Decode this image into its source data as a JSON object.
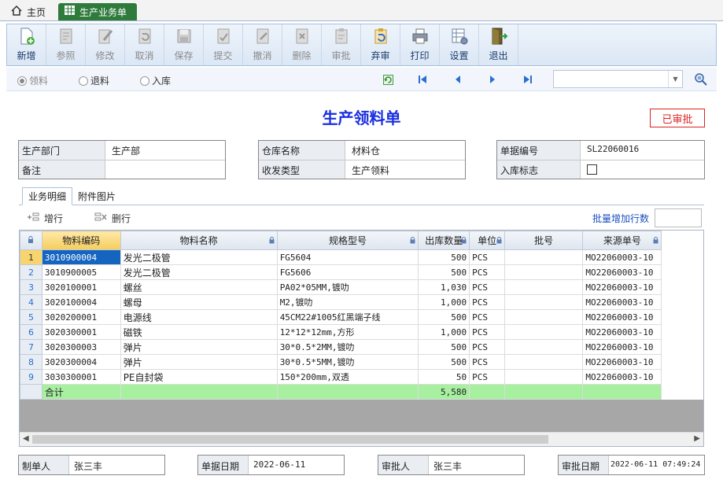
{
  "tabs": {
    "home": "主页",
    "active": "生产业务单"
  },
  "toolbar": [
    {
      "key": "new",
      "label": "新增",
      "state": "enabled",
      "icon": "new-doc-icon"
    },
    {
      "key": "ref",
      "label": "参照",
      "state": "disabled",
      "icon": "reference-icon"
    },
    {
      "key": "edit",
      "label": "修改",
      "state": "disabled",
      "icon": "edit-icon"
    },
    {
      "key": "cancel",
      "label": "取消",
      "state": "disabled",
      "icon": "undo-icon"
    },
    {
      "key": "save",
      "label": "保存",
      "state": "disabled",
      "icon": "save-icon"
    },
    {
      "key": "submit",
      "label": "提交",
      "state": "disabled",
      "icon": "submit-icon"
    },
    {
      "key": "revoke",
      "label": "撤消",
      "state": "disabled",
      "icon": "revoke-icon"
    },
    {
      "key": "delete",
      "label": "删除",
      "state": "disabled",
      "icon": "delete-icon"
    },
    {
      "key": "audit",
      "label": "审批",
      "state": "disabled",
      "icon": "audit-icon"
    },
    {
      "key": "unaudit",
      "label": "弃审",
      "state": "enabled",
      "icon": "unaudit-icon"
    },
    {
      "key": "print",
      "label": "打印",
      "state": "enabled",
      "icon": "print-icon"
    },
    {
      "key": "settings",
      "label": "设置",
      "state": "enabled",
      "icon": "settings-icon"
    },
    {
      "key": "exit",
      "label": "退出",
      "state": "enabled",
      "icon": "exit-icon"
    }
  ],
  "radios": {
    "pick": "领料",
    "return": "退料",
    "instock": "入库",
    "selected": "领料"
  },
  "doc": {
    "title": "生产领料单",
    "status": "已审批"
  },
  "header": {
    "dept_label": "生产部门",
    "dept_value": "生产部",
    "note_label": "备注",
    "note_value": "",
    "warehouse_label": "仓库名称",
    "warehouse_value": "材料仓",
    "iotype_label": "收发类型",
    "iotype_value": "生产领料",
    "docno_label": "单据编号",
    "docno_value": "SL22060016",
    "instock_label": "入库标志",
    "instock_checked": false
  },
  "subtabs": {
    "detail": "业务明细",
    "attach": "附件图片"
  },
  "grid_toolbar": {
    "add_row": "增行",
    "del_row": "删行",
    "batch_add": "批量增加行数",
    "batch_value": ""
  },
  "grid": {
    "columns": [
      "物料编码",
      "物料名称",
      "规格型号",
      "出库数量",
      "单位",
      "批号",
      "来源单号"
    ],
    "rows": [
      [
        "3010900004",
        "发光二极管",
        "FG5604",
        "500",
        "PCS",
        "",
        "MO22060003-10"
      ],
      [
        "3010900005",
        "发光二极管",
        "FG5606",
        "500",
        "PCS",
        "",
        "MO22060003-10"
      ],
      [
        "3020100001",
        "螺丝",
        "PA02*05MM,镀叻",
        "1,030",
        "PCS",
        "",
        "MO22060003-10"
      ],
      [
        "3020100004",
        "螺母",
        "M2,镀叻",
        "1,000",
        "PCS",
        "",
        "MO22060003-10"
      ],
      [
        "3020200001",
        "电源线",
        "45CM22#1005红黑端子线",
        "500",
        "PCS",
        "",
        "MO22060003-10"
      ],
      [
        "3020300001",
        "磁铁",
        "12*12*12mm,方形",
        "1,000",
        "PCS",
        "",
        "MO22060003-10"
      ],
      [
        "3020300003",
        "弹片",
        "30*0.5*2MM,镀叻",
        "500",
        "PCS",
        "",
        "MO22060003-10"
      ],
      [
        "3020300004",
        "弹片",
        "30*0.5*5MM,镀叻",
        "500",
        "PCS",
        "",
        "MO22060003-10"
      ],
      [
        "3030300001",
        "PE自封袋",
        "150*200mm,双透",
        "50",
        "PCS",
        "",
        "MO22060003-10"
      ]
    ],
    "row_numbers": [
      "1",
      "2",
      "3",
      "4",
      "5",
      "6",
      "7",
      "8",
      "9"
    ],
    "total_label": "合计",
    "total_qty": "5,580"
  },
  "footer": {
    "maker_label": "制单人",
    "maker_value": "张三丰",
    "date_label": "单据日期",
    "date_value": "2022-06-11",
    "approver_label": "审批人",
    "approver_value": "张三丰",
    "approve_date_label": "审批日期",
    "approve_date_value": "2022-06-11 07:49:24"
  },
  "colors": {
    "active_tab": "#2e7b3c",
    "title": "#1a2ee0",
    "status": "#dd2222",
    "selected_cell": "#1565c0",
    "total_row": "#a6f0a0"
  }
}
